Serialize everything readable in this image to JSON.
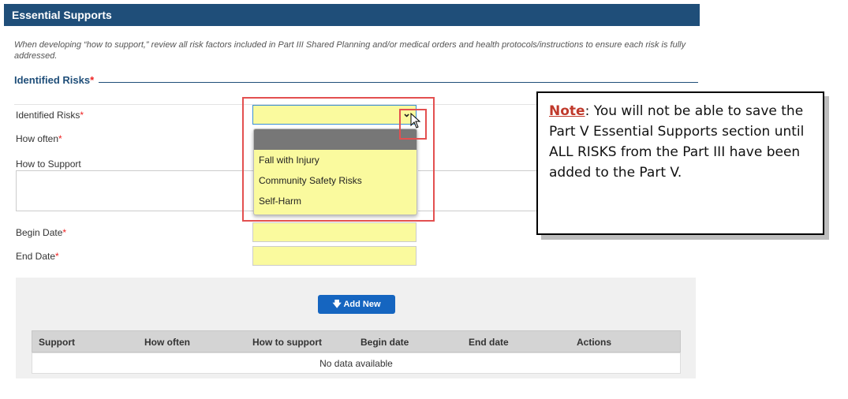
{
  "header": {
    "title": "Essential Supports"
  },
  "instructions": "When developing “how to support,” review all risk factors included in Part III Shared Planning and/or medical orders and health protocols/instructions to ensure each risk is fully addressed.",
  "section": {
    "title": "Identified Risks",
    "required_mark": "*"
  },
  "form": {
    "identified_risks_label": "Identified Risks",
    "how_often_label": "How often",
    "how_to_support_label": "How to Support",
    "begin_date_label": "Begin Date",
    "end_date_label": "End Date",
    "required_mark": "*",
    "risk_dropdown": {
      "selected": "",
      "options": [
        "Fall with Injury",
        "Community Safety Risks",
        "Self-Harm"
      ]
    }
  },
  "note": {
    "label": "Note",
    "text": ": You will not be able to save the Part V Essential Supports section until ALL RISKS from the Part III have been added to the Part V."
  },
  "grid": {
    "add_button_label": "Add New",
    "columns": [
      "Support",
      "How often",
      "How to support",
      "Begin date",
      "End date",
      "Actions"
    ],
    "empty_text": "No data available"
  },
  "colors": {
    "header_bg": "#1f4e79",
    "field_bg": "#fafa9e",
    "highlight_red": "#e35050",
    "button_blue": "#1565c0",
    "required_star": "#ee2222"
  },
  "icons": {
    "dropdown": "chevron-down-icon",
    "cursor": "mouse-pointer-icon",
    "add": "arrow-down-icon"
  }
}
